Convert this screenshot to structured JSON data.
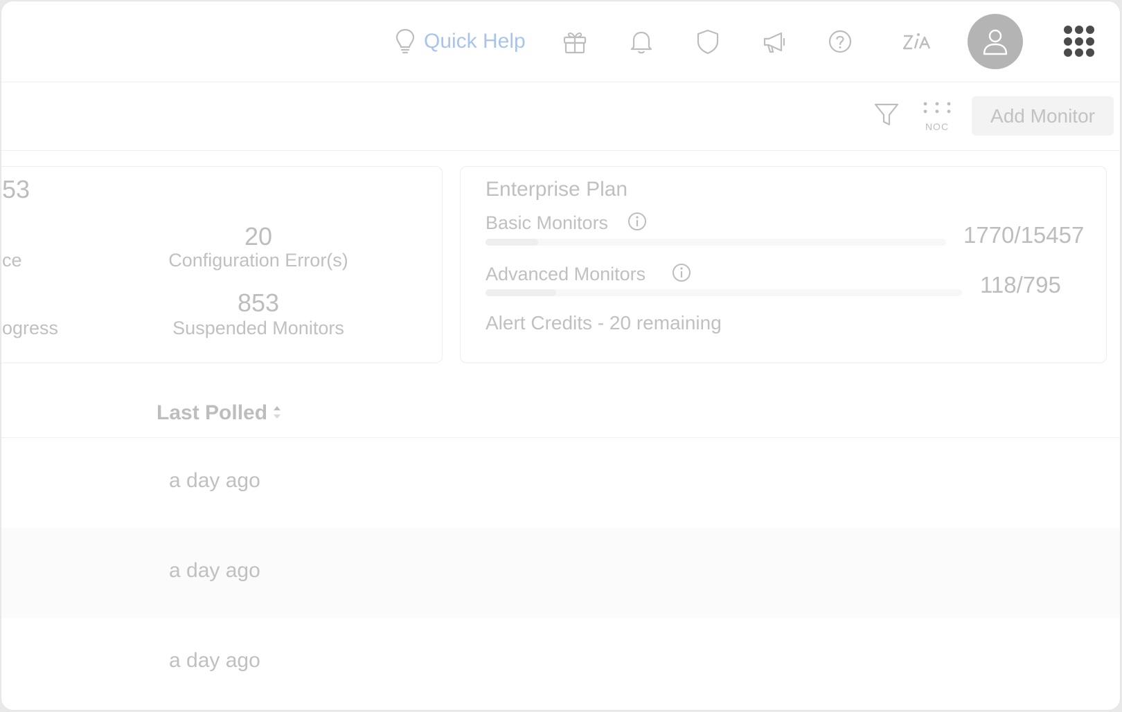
{
  "header": {
    "quick_help_label": "Quick Help",
    "icons": [
      "lightbulb-icon",
      "gift-icon",
      "bell-icon",
      "shield-icon",
      "megaphone-icon",
      "help-icon",
      "zia-icon",
      "user-icon",
      "apps-grid-icon"
    ]
  },
  "toolbar": {
    "noc_label": "NOC",
    "add_monitor_label": "Add Monitor"
  },
  "summary": {
    "partial_top_value": "53",
    "partial_label_1": "ce",
    "partial_label_2": "ogress",
    "configuration_errors_value": "20",
    "configuration_errors_label": "Configuration Error(s)",
    "suspended_value": "853",
    "suspended_label": "Suspended Monitors"
  },
  "plan": {
    "title": "Enterprise Plan",
    "basic_label": "Basic Monitors",
    "basic_value": "1770/15457",
    "basic_fraction": 0.115,
    "advanced_label": "Advanced Monitors",
    "advanced_value": "118/795",
    "advanced_fraction": 0.148,
    "alert_credits": "Alert Credits - 20 remaining"
  },
  "table": {
    "columns": [
      "Last Polled"
    ],
    "rows": [
      {
        "last_polled": "a day ago"
      },
      {
        "last_polled": "a day ago"
      },
      {
        "last_polled": "a day ago"
      }
    ]
  },
  "colors": {
    "accent_link": "#a9c4ec",
    "avatar_bg": "#b4b4b4",
    "apps_dots": "#4b4b4b"
  }
}
